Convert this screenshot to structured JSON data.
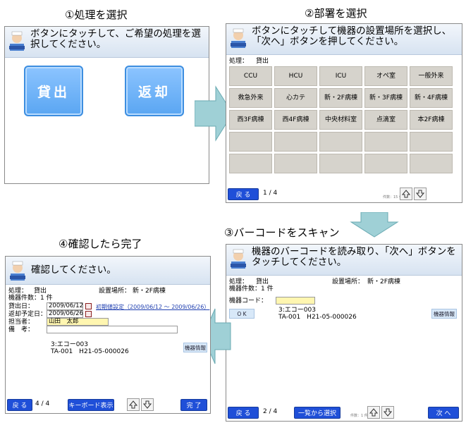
{
  "steps": {
    "s1": "①処理を選択",
    "s2": "②部署を選択",
    "s3": "③バーコードをスキャン",
    "s4": "④確認したら完了"
  },
  "panel1": {
    "message": "ボタンにタッチして、ご希望の処理を選択してください。",
    "buttons": [
      "貸出",
      "返却"
    ]
  },
  "panel2": {
    "message": "ボタンにタッチして機器の設置場所を選択し、「次へ」ボタンを押してください。",
    "process_label": "処理：",
    "process_value": "貸出",
    "departments": [
      "CCU",
      "HCU",
      "ICU",
      "オペ室",
      "一般外来",
      "救急外来",
      "心カテ",
      "新・2F病棟",
      "新・3F病棟",
      "新・4F病棟",
      "西3F病棟",
      "西4F病棟",
      "中央材料室",
      "点滴室",
      "本2F病棟",
      "",
      "",
      "",
      "",
      "",
      "",
      "",
      "",
      "",
      ""
    ],
    "back": "戻 る",
    "page": "1 / 4",
    "tiny": "件数：15 件"
  },
  "panel3": {
    "message": "機器のバーコードを読み取り、「次へ」ボタンをタッチしてください。",
    "process_label": "処理：",
    "process_value": "貸出",
    "location_label": "設置場所：",
    "location_value": "新・2F病棟",
    "count_label": "機器件数：1 件",
    "code_label": "機器コード：",
    "ok": "O K",
    "item_line1": "3:エコー003",
    "item_line2": "TA-001　H21-05-000026",
    "equip_info": "機器情報",
    "back": "戻 る",
    "page": "2 / 4",
    "select_list": "一覧から選択",
    "next": "次 へ",
    "tiny": "件数：1 件"
  },
  "panel4": {
    "message": "確認してください。",
    "process_label": "処理：",
    "process_value": "貸出",
    "location_label": "設置場所：",
    "location_value": "新・2F病棟",
    "count_label": "機器件数：1 件",
    "lend_label": "貸出日：",
    "lend_value": "2009/06/12",
    "return_label": "返却予定日：",
    "return_value": "2009/06/26",
    "initial_link": "初期値設定（2009/06/12 ～ 2009/06/26）",
    "staff_label": "担当者：",
    "staff_value": "山田　太郎",
    "note_label": "備　考：",
    "item_line1": "3:エコー003",
    "item_line2": "TA-001　H21-05-000026",
    "equip_info": "機器情報",
    "back": "戻 る",
    "page": "4 / 4",
    "keyboard": "キーボード表示",
    "done": "完 了"
  },
  "colors": {
    "footer_button": "#1f4fd8",
    "big_button": "#5aa6f2",
    "header": "#d7e3f1",
    "flow_arrow": "#9fd0d6"
  }
}
